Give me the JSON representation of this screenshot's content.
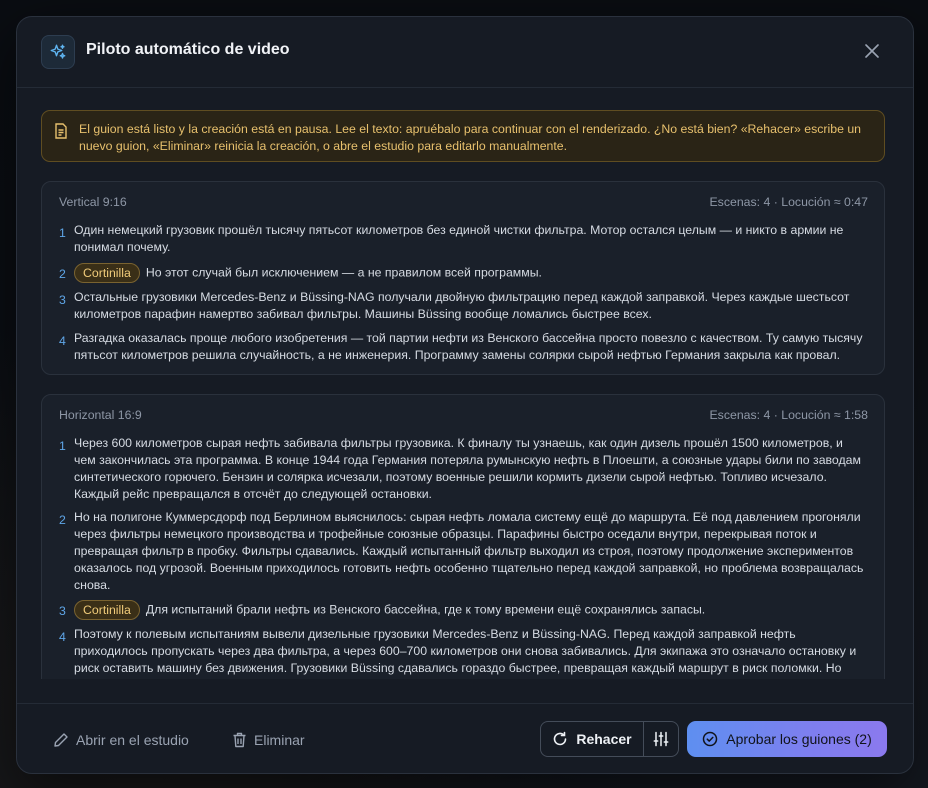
{
  "modal": {
    "title": "Piloto automático de video"
  },
  "notice": {
    "text": "El guion está listo y la creación está en pausa. Lee el texto: apruébalo para continuar con el renderizado. ¿No está bien? «Rehacer» escribe un nuevo guion, «Eliminar» reinicia la creación, o abre el estudio para editarlo manualmente."
  },
  "scripts": [
    {
      "format": "Vertical 9:16",
      "meta": "Escenas: 4 · Locución ≈ 0:47",
      "scenes": [
        {
          "num": "1",
          "tag": "",
          "text": "Один немецкий грузовик прошёл тысячу пятьсот километров без единой чистки фильтра. Мотор остался целым — и никто в армии не понимал почему."
        },
        {
          "num": "2",
          "tag": "Cortinilla",
          "text": "Но этот случай был исключением — а не правилом всей программы."
        },
        {
          "num": "3",
          "tag": "",
          "text": "Остальные грузовики Mercedes-Benz и Büssing-NAG получали двойную фильтрацию перед каждой заправкой. Через каждые шестьсот километров парафин намертво забивал фильтры. Машины Büssing вообще ломались быстрее всех."
        },
        {
          "num": "4",
          "tag": "",
          "text": "Разгадка оказалась проще любого изобретения — той партии нефти из Венского бассейна просто повезло с качеством. Ту самую тысячу пятьсот километров решила случайность, а не инженерия. Программу замены солярки сырой нефтью Германия закрыла как провал."
        }
      ]
    },
    {
      "format": "Horizontal 16:9",
      "meta": "Escenas: 4 · Locución ≈ 1:58",
      "scenes": [
        {
          "num": "1",
          "tag": "",
          "text": "Через 600 километров сырая нефть забивала фильтры грузовика. К финалу ты узнаешь, как один дизель прошёл 1500 километров, и чем закончилась эта программа. В конце 1944 года Германия потеряла румынскую нефть в Плоешти, а союзные удары били по заводам синтетического горючего. Бензин и солярка исчезали, поэтому военные решили кормить дизели сырой нефтью. Топливо исчезало. Каждый рейс превращался в отсчёт до следующей остановки."
        },
        {
          "num": "2",
          "tag": "",
          "text": "Но на полигоне Куммерсдорф под Берлином выяснилось: сырая нефть ломала систему ещё до маршрута. Её под давлением прогоняли через фильтры немецкого производства и трофейные союзные образцы. Парафины быстро оседали внутри, перекрывая поток и превращая фильтр в пробку. Фильтры сдавались. Каждый испытанный фильтр выходил из строя, поэтому продолжение экспериментов оказалось под угрозой. Военным приходилось готовить нефть особенно тщательно перед каждой заправкой, но проблема возвращалась снова."
        },
        {
          "num": "3",
          "tag": "Cortinilla",
          "text": "Для испытаний брали нефть из Венского бассейна, где к тому времени ещё сохранялись запасы."
        },
        {
          "num": "4",
          "tag": "",
          "text": "Поэтому к полевым испытаниям вывели дизельные грузовики Mercedes-Benz и Büssing-NAG. Перед каждой заправкой нефть приходилось пропускать через два фильтра, а через 600–700 километров они снова забивались. Для экипажа это означало остановку и риск оставить машину без движения. Грузовики Büssing сдавались гораздо быстрее, превращая каждый маршрут в риск поломки. Но"
        }
      ]
    }
  ],
  "footer": {
    "open_studio": "Abrir en el estudio",
    "delete": "Eliminar",
    "redo": "Rehacer",
    "approve": "Aprobar los guiones (2)"
  },
  "icons": {
    "header": "sparkles-icon",
    "close": "close-icon",
    "notice": "document-icon",
    "open_studio": "pencil-icon",
    "delete": "trash-icon",
    "redo": "refresh-icon",
    "settings": "sliders-icon",
    "approve": "check-circle-icon"
  },
  "colors": {
    "accent": "#6c8cf0",
    "warning": "#e7c06d",
    "scene_number": "#5fa6e8"
  }
}
